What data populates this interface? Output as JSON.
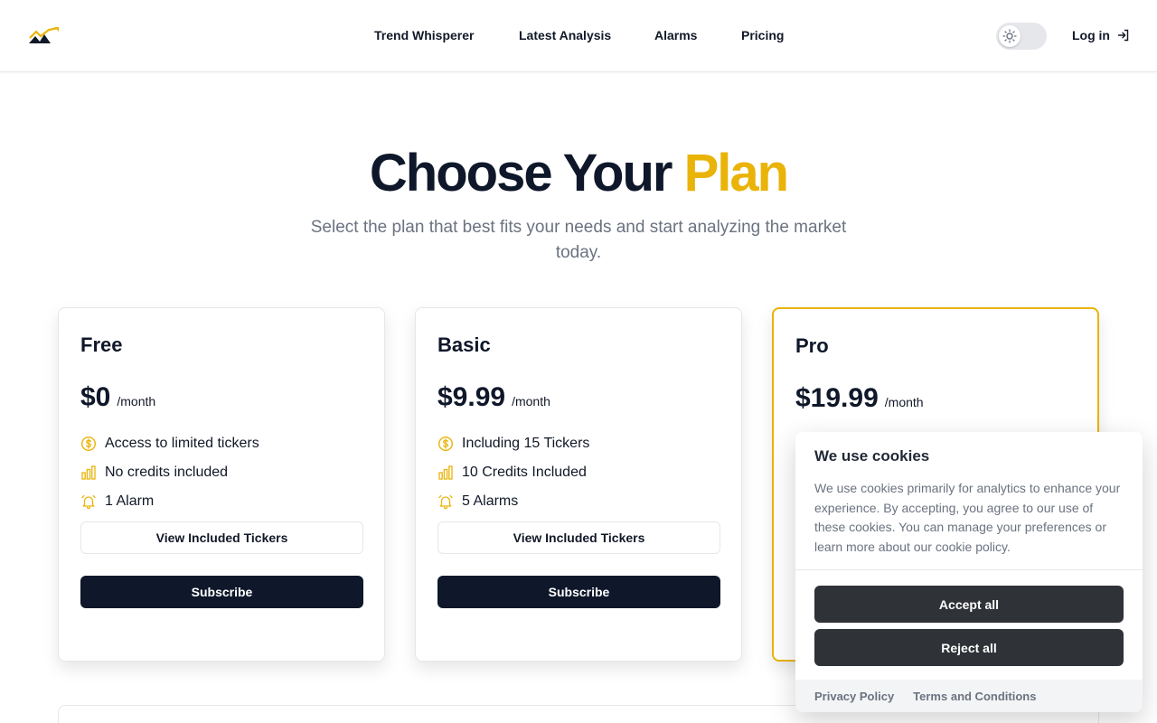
{
  "nav": {
    "items": [
      "Trend Whisperer",
      "Latest Analysis",
      "Alarms",
      "Pricing"
    ],
    "login_label": "Log in"
  },
  "hero": {
    "title_main": "Choose Your ",
    "title_accent": "Plan",
    "subtitle": "Select the plan that best fits your needs and start analyzing the market today."
  },
  "plans": [
    {
      "name": "Free",
      "price": "$0",
      "period": "/month",
      "features": [
        {
          "icon": "dollar-icon",
          "text": "Access to limited tickers"
        },
        {
          "icon": "bar-chart-icon",
          "text": "No credits included"
        },
        {
          "icon": "bell-icon",
          "text": "1 Alarm"
        }
      ],
      "view_label": "View Included Tickers",
      "subscribe_label": "Subscribe"
    },
    {
      "name": "Basic",
      "price": "$9.99",
      "period": "/month",
      "features": [
        {
          "icon": "dollar-icon",
          "text": "Including 15 Tickers"
        },
        {
          "icon": "bar-chart-icon",
          "text": "10 Credits Included"
        },
        {
          "icon": "bell-icon",
          "text": "5 Alarms"
        }
      ],
      "view_label": "View Included Tickers",
      "subscribe_label": "Subscribe"
    },
    {
      "name": "Pro",
      "price": "$19.99",
      "period": "/month"
    }
  ],
  "cookie": {
    "title": "We use cookies",
    "text": "We use cookies primarily for analytics to enhance your experience. By accepting, you agree to our use of these cookies. You can manage your preferences or learn more about our cookie policy.",
    "accept_label": "Accept all",
    "reject_label": "Reject all",
    "privacy_label": "Privacy Policy",
    "terms_label": "Terms and Conditions"
  },
  "colors": {
    "accent": "#eab308",
    "dark": "#0f172a",
    "cookie_button": "#2f3237"
  }
}
